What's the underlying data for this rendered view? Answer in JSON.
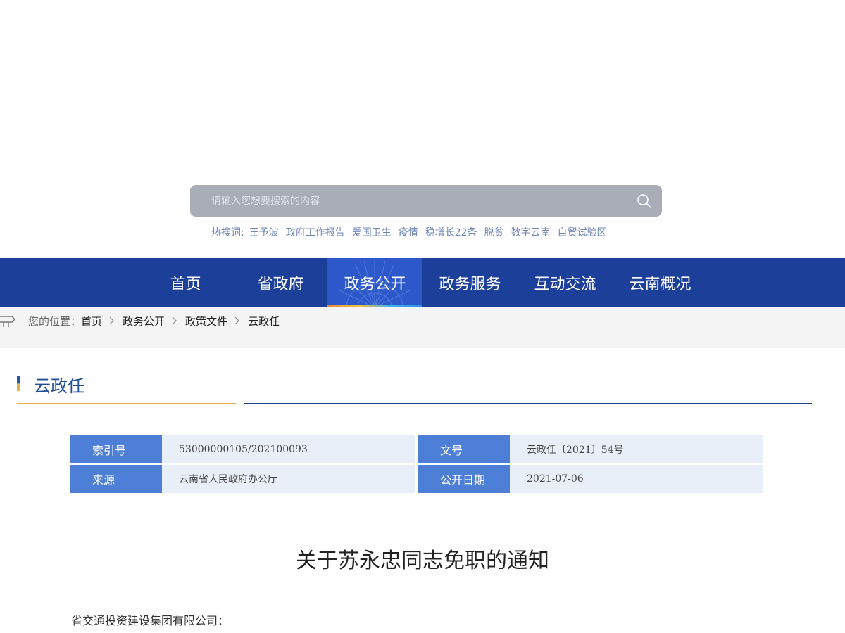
{
  "search": {
    "placeholder": "请输入您想要搜索的内容",
    "icon": "search-icon"
  },
  "hotwords": {
    "label": "热搜词:",
    "items": [
      "王予波",
      "政府工作报告",
      "爱国卫生",
      "疫情",
      "稳增长22条",
      "脱贫",
      "数字云南",
      "自贸试验区"
    ]
  },
  "nav": {
    "items": [
      {
        "label": "首页"
      },
      {
        "label": "省政府"
      },
      {
        "label": "政务公开",
        "active": true
      },
      {
        "label": "政务服务"
      },
      {
        "label": "互动交流"
      },
      {
        "label": "云南概况"
      }
    ]
  },
  "breadcrumb": {
    "prefix": "您的位置：",
    "items": [
      "首页",
      "政务公开",
      "政策文件",
      "云政任"
    ]
  },
  "section": {
    "title": "云政任"
  },
  "info": {
    "index_key": "索引号",
    "index_value": "53000000105/202100093",
    "docno_key": "文号",
    "docno_value": "云政任〔2021〕54号",
    "source_key": "来源",
    "source_value": "云南省人民政府办公厅",
    "date_key": "公开日期",
    "date_value": "2021-07-06"
  },
  "document": {
    "title": "关于苏永忠同志免职的通知",
    "salutation": "省交通投资建设集团有限公司："
  },
  "colors": {
    "nav_bg": "#1c3f9a",
    "nav_active": "#2d58c9",
    "info_key_bg": "#4d7fd6",
    "info_val_bg": "#e9eff9",
    "section_title": "#1f4e97"
  }
}
